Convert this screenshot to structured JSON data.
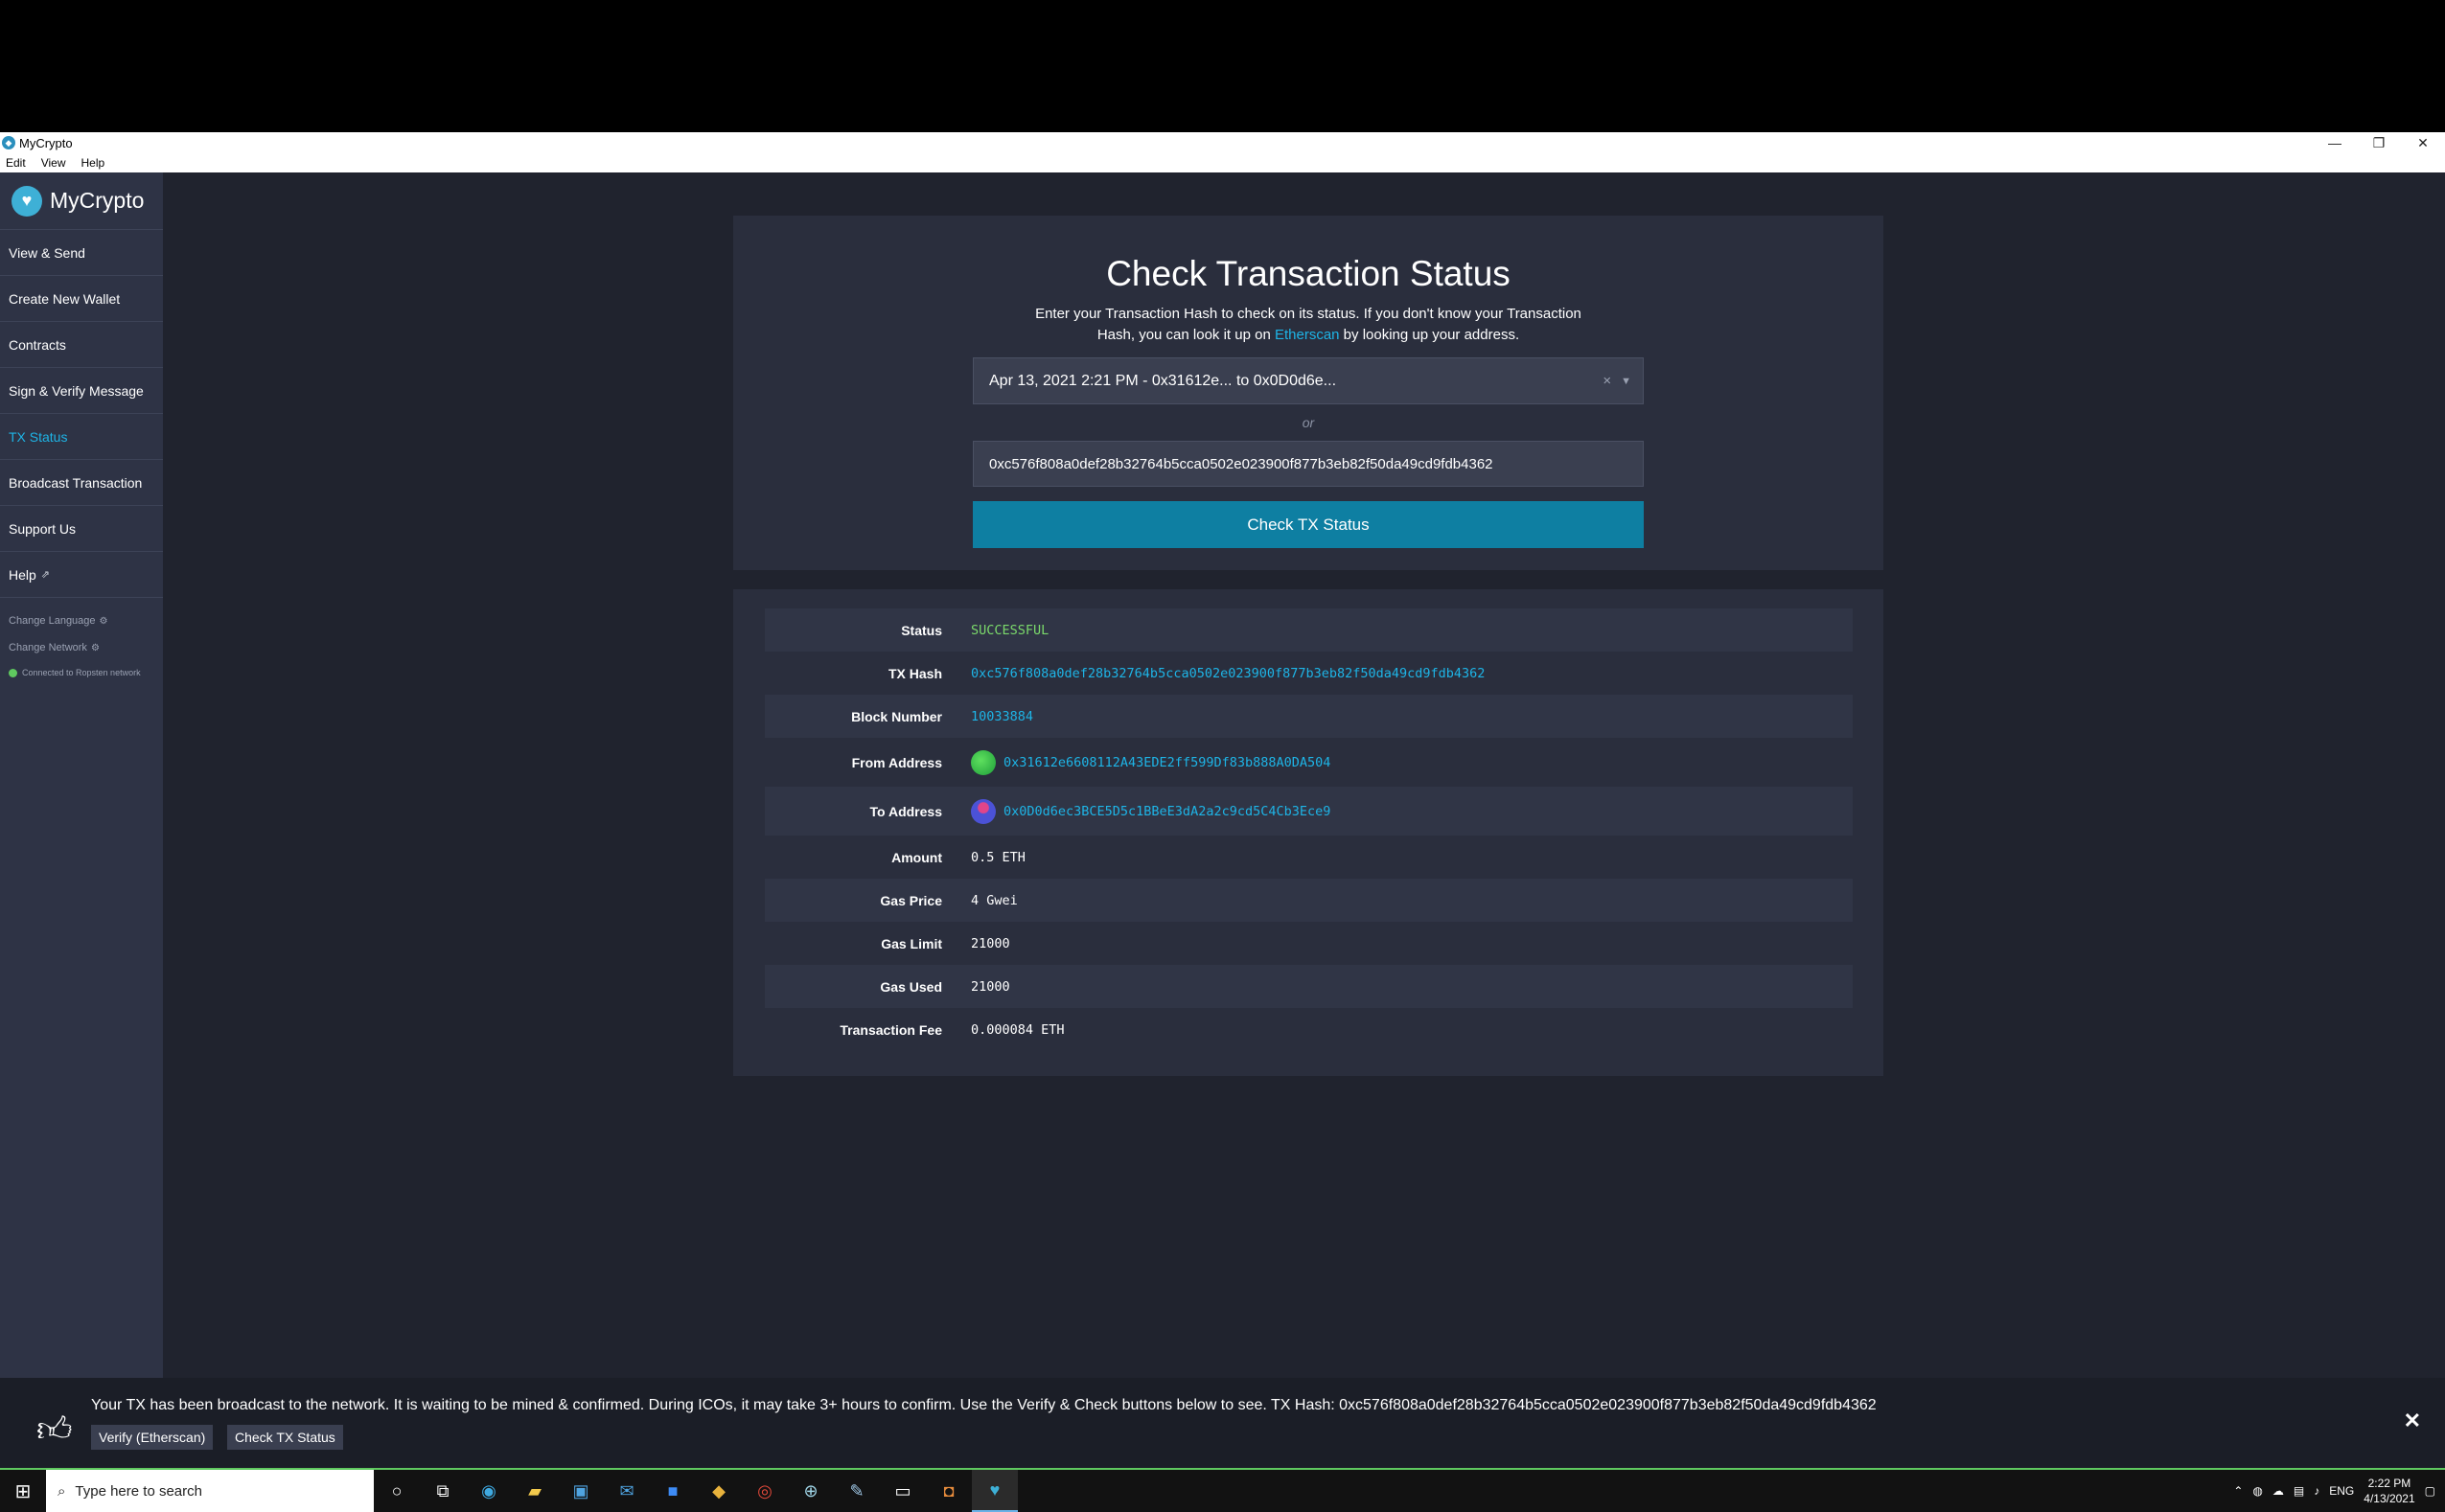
{
  "window": {
    "title": "MyCrypto",
    "minimize": "—",
    "restore": "❐",
    "close": "✕"
  },
  "menu": [
    "Edit",
    "View",
    "Help"
  ],
  "sidebar": {
    "brand": "MyCrypto",
    "items": [
      {
        "label": "View & Send",
        "active": false
      },
      {
        "label": "Create New Wallet",
        "active": false
      },
      {
        "label": "Contracts",
        "active": false
      },
      {
        "label": "Sign & Verify Message",
        "active": false
      },
      {
        "label": "TX Status",
        "active": true
      },
      {
        "label": "Broadcast Transaction",
        "active": false
      },
      {
        "label": "Support Us",
        "active": false
      },
      {
        "label": "Help",
        "active": false
      }
    ],
    "change_language": "Change Language",
    "change_network": "Change Network",
    "network_status": "Connected to Ropsten network"
  },
  "check": {
    "title": "Check Transaction Status",
    "desc_before": "Enter your Transaction Hash to check on its status. If you don't know your Transaction Hash, you can look it up on ",
    "desc_link": "Etherscan",
    "desc_after": " by looking up your address.",
    "selected_tx": "Apr 13, 2021 2:21 PM - 0x31612e... to 0x0D0d6e...",
    "or": "or",
    "hash_value": "0xc576f808a0def28b32764b5cca0502e023900f877b3eb82f50da49cd9fdb4362",
    "button": "Check TX Status"
  },
  "details": {
    "status": {
      "label": "Status",
      "value": "SUCCESSFUL"
    },
    "tx_hash": {
      "label": "TX Hash",
      "value": "0xc576f808a0def28b32764b5cca0502e023900f877b3eb82f50da49cd9fdb4362"
    },
    "block": {
      "label": "Block Number",
      "value": "10033884"
    },
    "from": {
      "label": "From Address",
      "value": "0x31612e6608112A43EDE2ff599Df83b888A0DA504"
    },
    "to": {
      "label": "To Address",
      "value": "0x0D0d6ec3BCE5D5c1BBeE3dA2a2c9cd5C4Cb3Ece9"
    },
    "amount": {
      "label": "Amount",
      "value": "0.5 ETH"
    },
    "gas_price": {
      "label": "Gas Price",
      "value": "4 Gwei"
    },
    "gas_limit": {
      "label": "Gas Limit",
      "value": "21000"
    },
    "gas_used": {
      "label": "Gas Used",
      "value": "21000"
    },
    "fee": {
      "label": "Transaction Fee",
      "value": "0.000084 ETH"
    }
  },
  "notification": {
    "text": "Your TX has been broadcast to the network. It is waiting to be mined & confirmed. During ICOs, it may take 3+ hours to confirm. Use the Verify & Check buttons below to see. TX Hash: 0xc576f808a0def28b32764b5cca0502e023900f877b3eb82f50da49cd9fdb4362",
    "verify_button": "Verify (Etherscan)",
    "check_button": "Check TX Status"
  },
  "taskbar": {
    "search_placeholder": "Type here to search",
    "language": "ENG",
    "time": "2:22 PM",
    "date": "4/13/2021"
  },
  "colors": {
    "accent": "#1eb4e6",
    "button": "#0e7fa2",
    "success": "#7bd96b",
    "sidebar": "#2e3345",
    "background": "#20232e"
  }
}
